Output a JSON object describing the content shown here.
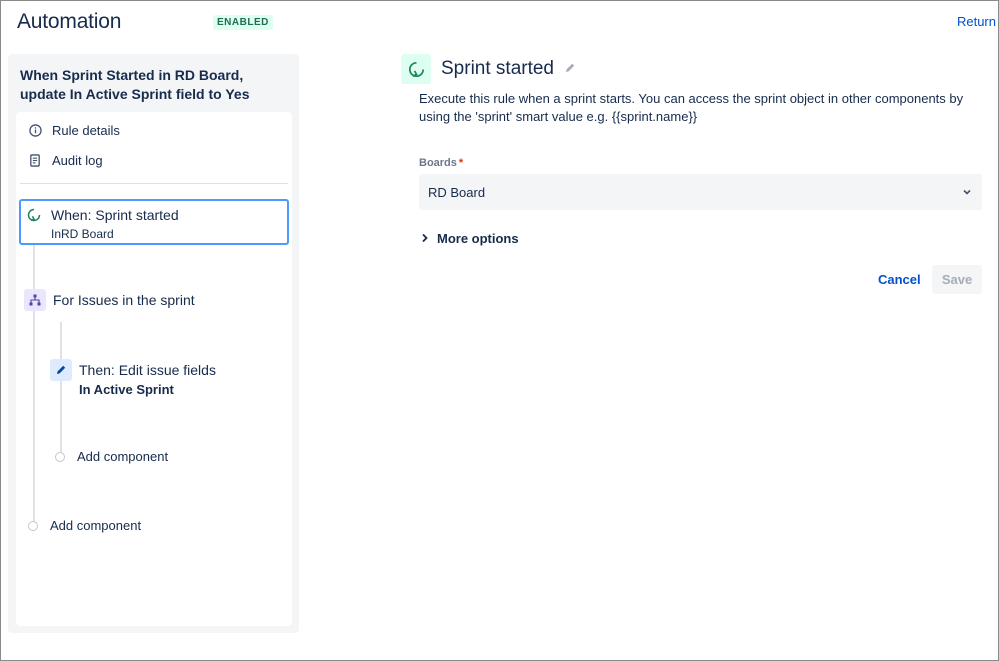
{
  "header": {
    "title": "Automation",
    "status": "ENABLED",
    "return_label": "Return"
  },
  "rule": {
    "name": "When Sprint Started in RD Board, update In Active Sprint field to Yes"
  },
  "menu": {
    "rule_details": "Rule details",
    "audit_log": "Audit log"
  },
  "flow": {
    "trigger": {
      "title": "When: Sprint started",
      "sub_prefix": "In",
      "sub_value": "RD Board",
      "icon": "sprint-icon"
    },
    "branch": {
      "label": "For Issues in the sprint",
      "icon": "branch-icon"
    },
    "action": {
      "title": "Then: Edit issue fields",
      "sub": "In Active Sprint",
      "icon": "pencil-icon"
    },
    "add_component_inner": "Add component",
    "add_component_outer": "Add component"
  },
  "config": {
    "title": "Sprint started",
    "description": "Execute this rule when a sprint starts. You can access the sprint object in other components by using the 'sprint' smart value e.g. {{sprint.name}}",
    "boards_label": "Boards",
    "boards_required": "*",
    "boards_value": "RD Board",
    "more_options": "More options",
    "cancel": "Cancel",
    "save": "Save"
  },
  "colors": {
    "link": "#0052cc",
    "enabled_bg": "#dcfff1",
    "enabled_text": "#216e4e",
    "selected_border": "#4c9aff"
  }
}
